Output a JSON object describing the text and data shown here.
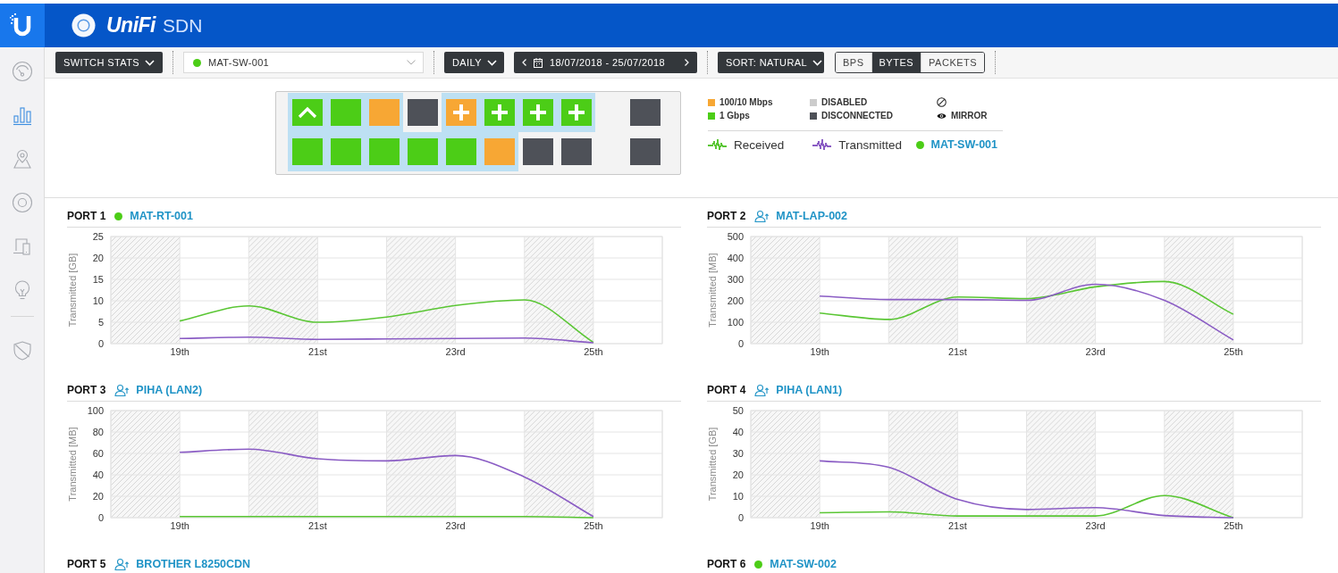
{
  "header": {
    "brand": "UniFi",
    "product": "SDN"
  },
  "sidebar": {
    "items": [
      {
        "kind": "gauge",
        "selected": false
      },
      {
        "kind": "bars",
        "selected": true
      },
      {
        "kind": "map",
        "selected": false
      },
      {
        "kind": "ring",
        "selected": false
      },
      {
        "kind": "devices",
        "selected": false
      },
      {
        "kind": "bulb",
        "selected": false
      }
    ],
    "footer_items": [
      {
        "kind": "shield",
        "selected": false
      }
    ]
  },
  "toolbar": {
    "view_menu": {
      "label": "SWITCH STATS"
    },
    "device_select": {
      "value": "MAT-SW-001",
      "online": true
    },
    "interval_menu": {
      "label": "DAILY"
    },
    "date_range": {
      "label": "18/07/2018 - 25/07/2018"
    },
    "sort_menu": {
      "label": "SORT: NATURAL"
    },
    "units": [
      {
        "label": "BPS",
        "selected": false
      },
      {
        "label": "BYTES",
        "selected": true
      },
      {
        "label": "PACKETS",
        "selected": false
      }
    ]
  },
  "switch_panel": {
    "rows": [
      {
        "ports": [
          {
            "color": "#4ccd17",
            "kind": "uplink",
            "selected": true
          },
          {
            "color": "#4ccd17",
            "kind": "plain",
            "selected": true
          },
          {
            "color": "#f7a734",
            "kind": "plain",
            "selected": true
          },
          {
            "color": "#4e5158",
            "kind": "plain",
            "selected": false
          },
          {
            "color": "#f7a734",
            "kind": "poe",
            "selected": true
          },
          {
            "color": "#4ccd17",
            "kind": "poe",
            "selected": true
          },
          {
            "color": "#4ccd17",
            "kind": "poe",
            "selected": true
          },
          {
            "color": "#4ccd17",
            "kind": "poe",
            "selected": true
          }
        ],
        "sfp": {
          "color": "#4e5158",
          "selected": false
        }
      },
      {
        "ports": [
          {
            "color": "#4ccd17",
            "kind": "plain",
            "selected": true
          },
          {
            "color": "#4ccd17",
            "kind": "plain",
            "selected": true
          },
          {
            "color": "#4ccd17",
            "kind": "plain",
            "selected": true
          },
          {
            "color": "#4ccd17",
            "kind": "plain",
            "selected": true
          },
          {
            "color": "#4ccd17",
            "kind": "plain",
            "selected": true
          },
          {
            "color": "#f7a734",
            "kind": "plain",
            "selected": true
          },
          {
            "color": "#4e5158",
            "kind": "plain",
            "selected": false
          },
          {
            "color": "#4e5158",
            "kind": "plain",
            "selected": false
          }
        ],
        "sfp": {
          "color": "#4e5158",
          "selected": false
        }
      }
    ]
  },
  "legend": {
    "items": [
      {
        "kind": "swatch",
        "label": "100/10 Mbps",
        "color": "#f7a734"
      },
      {
        "kind": "swatch",
        "label": "1 Gbps",
        "color": "#4ccd17"
      },
      {
        "kind": "swatch",
        "label": "DISABLED",
        "color": "#cccccc"
      },
      {
        "kind": "swatch",
        "label": "DISCONNECTED",
        "color": "#4e5158"
      },
      {
        "kind": "blocked"
      },
      {
        "kind": "mirror",
        "label": "MIRROR"
      }
    ],
    "series": [
      {
        "label": "Received",
        "color": "#5ac634"
      },
      {
        "label": "Transmitted",
        "color": "#8a5cc4"
      }
    ],
    "device": {
      "label": "MAT-SW-001",
      "online": true
    }
  },
  "port_charts": [
    {
      "label": "PORT 1",
      "device": "MAT-RT-001",
      "kind": "device",
      "chart_data": {
        "type": "line",
        "ylabel": "Transmitted [GB]",
        "x": [
          19,
          20,
          21,
          22,
          23,
          24,
          25
        ],
        "xlim": [
          18,
          26
        ],
        "ylim": [
          0,
          25
        ],
        "xticks": [
          {
            "value": 19,
            "label": "19th"
          },
          {
            "value": 21,
            "label": "21st"
          },
          {
            "value": 23,
            "label": "23rd"
          },
          {
            "value": 25,
            "label": "25th"
          }
        ],
        "yticks": [
          0,
          5,
          10,
          15,
          20,
          25
        ],
        "grid": true,
        "series": [
          {
            "color": "#5ac634",
            "values": [
              5.3,
              8.8,
              5.0,
              6.2,
              8.9,
              10.2,
              0.3
            ]
          },
          {
            "color": "#8a5cc4",
            "values": [
              1.2,
              1.5,
              1.0,
              1.1,
              1.2,
              1.3,
              0.2
            ]
          }
        ]
      }
    },
    {
      "label": "PORT 2",
      "device": "MAT-LAP-002",
      "kind": "client",
      "chart_data": {
        "type": "line",
        "ylabel": "Transmitted [MB]",
        "x": [
          19,
          20,
          21,
          22,
          23,
          24,
          25
        ],
        "xlim": [
          18,
          26
        ],
        "ylim": [
          0,
          500
        ],
        "xticks": [
          {
            "value": 19,
            "label": "19th"
          },
          {
            "value": 21,
            "label": "21st"
          },
          {
            "value": 23,
            "label": "23rd"
          },
          {
            "value": 25,
            "label": "25th"
          }
        ],
        "yticks": [
          0,
          100,
          200,
          300,
          400,
          500
        ],
        "grid": true,
        "series": [
          {
            "color": "#5ac634",
            "values": [
              143,
              113,
              218,
              210,
              265,
              290,
              137
            ]
          },
          {
            "color": "#8a5cc4",
            "values": [
              222,
              206,
              206,
              202,
              277,
              202,
              17
            ]
          }
        ]
      }
    },
    {
      "label": "PORT 3",
      "device": "PIHA (LAN2)",
      "kind": "client",
      "chart_data": {
        "type": "line",
        "ylabel": "Transmitted [MB]",
        "x": [
          19,
          20,
          21,
          22,
          23,
          24,
          25
        ],
        "xlim": [
          18,
          26
        ],
        "ylim": [
          0,
          100
        ],
        "xticks": [
          {
            "value": 19,
            "label": "19th"
          },
          {
            "value": 21,
            "label": "21st"
          },
          {
            "value": 23,
            "label": "23rd"
          },
          {
            "value": 25,
            "label": "25th"
          }
        ],
        "yticks": [
          0,
          20,
          40,
          60,
          80,
          100
        ],
        "grid": true,
        "series": [
          {
            "color": "#5ac634",
            "values": [
              1,
              1,
              1,
              1,
              1,
              1,
              0
            ]
          },
          {
            "color": "#8a5cc4",
            "values": [
              61,
              64,
              55,
              53,
              58,
              38,
              1
            ]
          }
        ]
      }
    },
    {
      "label": "PORT 4",
      "device": "PIHA (LAN1)",
      "kind": "client",
      "chart_data": {
        "type": "line",
        "ylabel": "Transmitted [GB]",
        "x": [
          19,
          20,
          21,
          22,
          23,
          24,
          25
        ],
        "xlim": [
          18,
          26
        ],
        "ylim": [
          0,
          50
        ],
        "xticks": [
          {
            "value": 19,
            "label": "19th"
          },
          {
            "value": 21,
            "label": "21st"
          },
          {
            "value": 23,
            "label": "23rd"
          },
          {
            "value": 25,
            "label": "25th"
          }
        ],
        "yticks": [
          0,
          10,
          20,
          30,
          40,
          50
        ],
        "grid": true,
        "series": [
          {
            "color": "#5ac634",
            "values": [
              2.3,
              2.7,
              0.8,
              0.8,
              0.8,
              10.3,
              0
            ]
          },
          {
            "color": "#8a5cc4",
            "values": [
              26.5,
              23.5,
              8.5,
              3.8,
              4.7,
              1.0,
              0
            ]
          }
        ]
      }
    },
    {
      "label": "PORT 5",
      "device": "BROTHER L8250CDN",
      "kind": "client"
    },
    {
      "label": "PORT 6",
      "device": "MAT-SW-002",
      "kind": "device"
    }
  ]
}
